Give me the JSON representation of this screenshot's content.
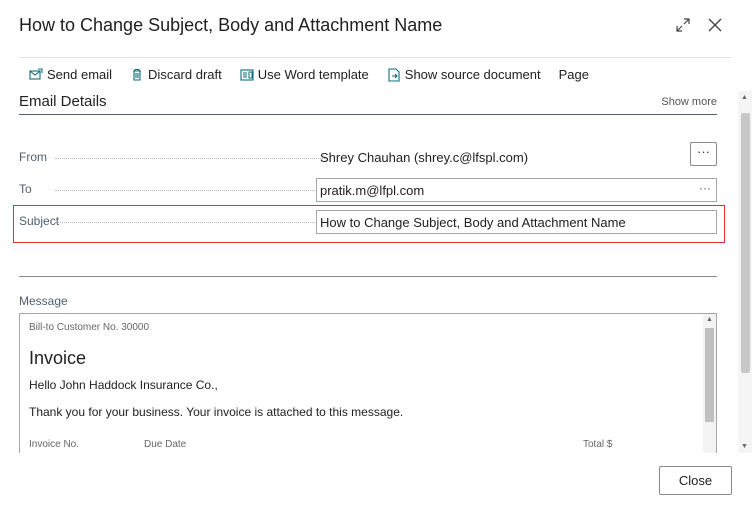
{
  "dialog": {
    "title": "How to Change Subject, Body and Attachment Name",
    "expand_icon": "expand-icon",
    "close_icon": "close-icon"
  },
  "actions": [
    {
      "label": "Send email",
      "icon": "send-email-icon"
    },
    {
      "label": "Discard draft",
      "icon": "trash-icon"
    },
    {
      "label": "Use Word template",
      "icon": "word-template-icon"
    },
    {
      "label": "Show source document",
      "icon": "source-document-icon"
    },
    {
      "label": "Page",
      "icon": ""
    }
  ],
  "section": {
    "title": "Email Details",
    "show_more": "Show more"
  },
  "fields": {
    "from": {
      "label": "From",
      "value": "Shrey Chauhan (shrey.c@lfspl.com)",
      "button": "···"
    },
    "to": {
      "label": "To",
      "value": "pratik.m@lfpl.com",
      "button": "···"
    },
    "subject": {
      "label": "Subject",
      "value": "How to Change Subject, Body and Attachment Name"
    }
  },
  "message": {
    "label": "Message",
    "bill_to": "Bill-to Customer No. 30000",
    "heading": "Invoice",
    "greeting": "Hello John Haddock Insurance Co.,",
    "body": "Thank you for your business. Your invoice is attached to this message.",
    "columns": [
      "Invoice No.",
      "Due Date",
      "Total $"
    ]
  },
  "footer": {
    "close_label": "Close"
  },
  "colors": {
    "accent": "#0f6b7a",
    "highlight": "#e03030"
  }
}
